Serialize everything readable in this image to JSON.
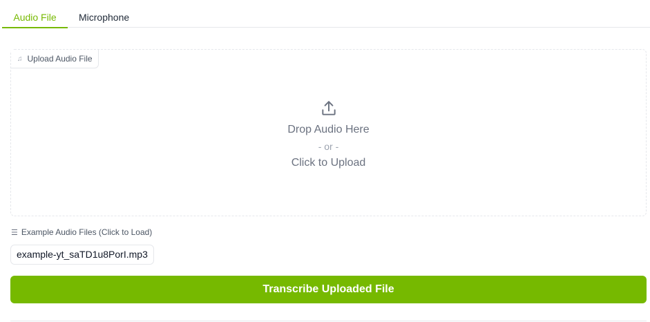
{
  "tabs": [
    {
      "label": "Audio File",
      "active": true
    },
    {
      "label": "Microphone",
      "active": false
    }
  ],
  "upload": {
    "label": "Upload Audio File",
    "icon": "music-note-icon",
    "drop_text": "Drop Audio Here",
    "or_text": "- or -",
    "click_text": "Click to Upload"
  },
  "examples": {
    "label": "Example Audio Files (Click to Load)",
    "items": [
      "example-yt_saTD1u8PorI.mp3"
    ]
  },
  "actions": {
    "transcribe_label": "Transcribe Uploaded File"
  },
  "colors": {
    "accent": "#76b900",
    "border": "#e5e7eb",
    "muted_text": "#6b7280"
  }
}
